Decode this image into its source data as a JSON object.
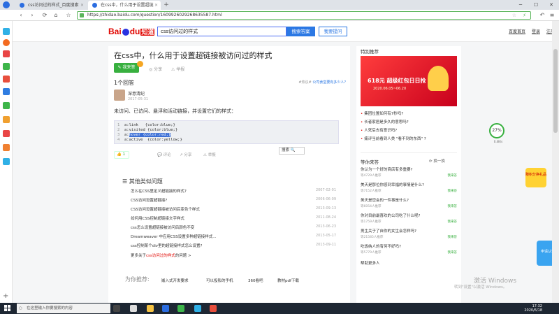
{
  "browser": {
    "tabs": [
      {
        "label": "css访问过的样式_百度搜索",
        "active": false
      },
      {
        "label": "在css中，什么用于设置超链接被...",
        "active": true
      }
    ],
    "url": "https://zhidao.baidu.com/question/1609926029268635587.html"
  },
  "header": {
    "logo_text": "Bai",
    "logo_text2": "du",
    "logo_suffix": "知道",
    "search_value": "css访问过的样式",
    "search_button": "搜索答案",
    "ask_button": "我要提问",
    "links": [
      "百度首页",
      "登录",
      "注册"
    ]
  },
  "question": {
    "title": "在css中，什么用于设置超链接被访问过的样式",
    "want_answer": "我来答",
    "share": "分享",
    "report": "举报",
    "answer_count": "1个回答",
    "related_prefix": "#热议#",
    "related_link": "公司食堂要有多少人?"
  },
  "answer": {
    "author": "深意清纪",
    "date": "2017-05-31",
    "text": "未访问、已访问、悬浮和活动链接，并设置它们的样式：",
    "code": [
      {
        "ln": "1",
        "text": "a:link   {color:blue;}"
      },
      {
        "ln": "2",
        "text": "a:visited {color:blue;}"
      },
      {
        "ln": "3",
        "pre": "a:",
        "sel": "hover",
        "mid": " ",
        "sel2": "{color:red;}",
        "post": ""
      },
      {
        "ln": "4",
        "text": "a:active  {color:yellow;}"
      }
    ],
    "selection_popup": "搜索",
    "likes": "1",
    "actions": [
      "评论",
      "分享",
      "举报"
    ]
  },
  "similar": {
    "title": "其他类似问题",
    "items": [
      {
        "title": "怎么在CSS里定义超链接的样式?",
        "date": "2007-02-01"
      },
      {
        "title": "CSS访问设置超链接?",
        "date": "2006-06-09"
      },
      {
        "title": "CSS访问设置超链接被访问后变色个样式",
        "date": "2013-09-13"
      },
      {
        "title": "如何用CSS控制超链接文字样式",
        "date": "2011-08-24"
      },
      {
        "title": "css怎么设置超链接被访问后颜色不变",
        "date": "2013-06-23"
      },
      {
        "title": "Dreamweaver 中应用CSS设置多种超链接样式...",
        "date": "2013-05-17"
      },
      {
        "title": "css控制某个div里的超链接样式怎么设置?",
        "date": "2013-09-11"
      }
    ],
    "more_prefix": "更多关于",
    "more_keyword": "css访问过的样式",
    "more_suffix": "的问题 >"
  },
  "recommend": {
    "title": "为你推荐:",
    "items": [
      "嵌入式开发要求",
      "可以投影的手机",
      "360看吧",
      "教材pdf下载"
    ]
  },
  "sidebar_right": {
    "special_title": "特别推荐",
    "ad_main": "618元 超级红包日日抢",
    "ad_sub": "2020.06.05~06.20",
    "hot": [
      "集团位置如何有7秒吗?",
      "长者家居是多久的意思吗?",
      "人死后去有意识吗?",
      "痛评当前看到人类 \"看不到的东西\" ?"
    ],
    "wait_title": "等你来答",
    "refresh": "换一换",
    "wait": [
      {
        "q": "你认为一个好的商店有多重要?",
        "meta": "等4729人推荐",
        "a": "我来答"
      },
      {
        "q": "美天是那位你感到幸福的事情是什么?",
        "meta": "等7152人推荐",
        "a": "我来答"
      },
      {
        "q": "美天是您会的一件事是什么?",
        "meta": "等6054人推荐",
        "a": "我来答"
      },
      {
        "q": "你对目前最喜欢的公司吃了什么呢?",
        "meta": "等1759人推荐",
        "a": "我来答"
      },
      {
        "q": "男生关于了自你的女生会怎样吗?",
        "meta": "等21585人推荐",
        "a": "我来答"
      },
      {
        "q": "吃饭纳人的有何不好吗?",
        "meta": "等5779人推荐",
        "a": "我来答"
      }
    ],
    "help_more": "帮助更多人"
  },
  "floating": {
    "circle_value": "27%",
    "circle_sub": "0.4K/s",
    "badge1": "赚积分换礼品",
    "badge2": "申请认证",
    "watermark1": "激活 Windows",
    "watermark2": "转到\"设置\"以激活 Windows。"
  },
  "taskbar": {
    "search_placeholder": "在这里输入你要搜索的内容",
    "time": "17:32",
    "date": "2020/6/18"
  }
}
